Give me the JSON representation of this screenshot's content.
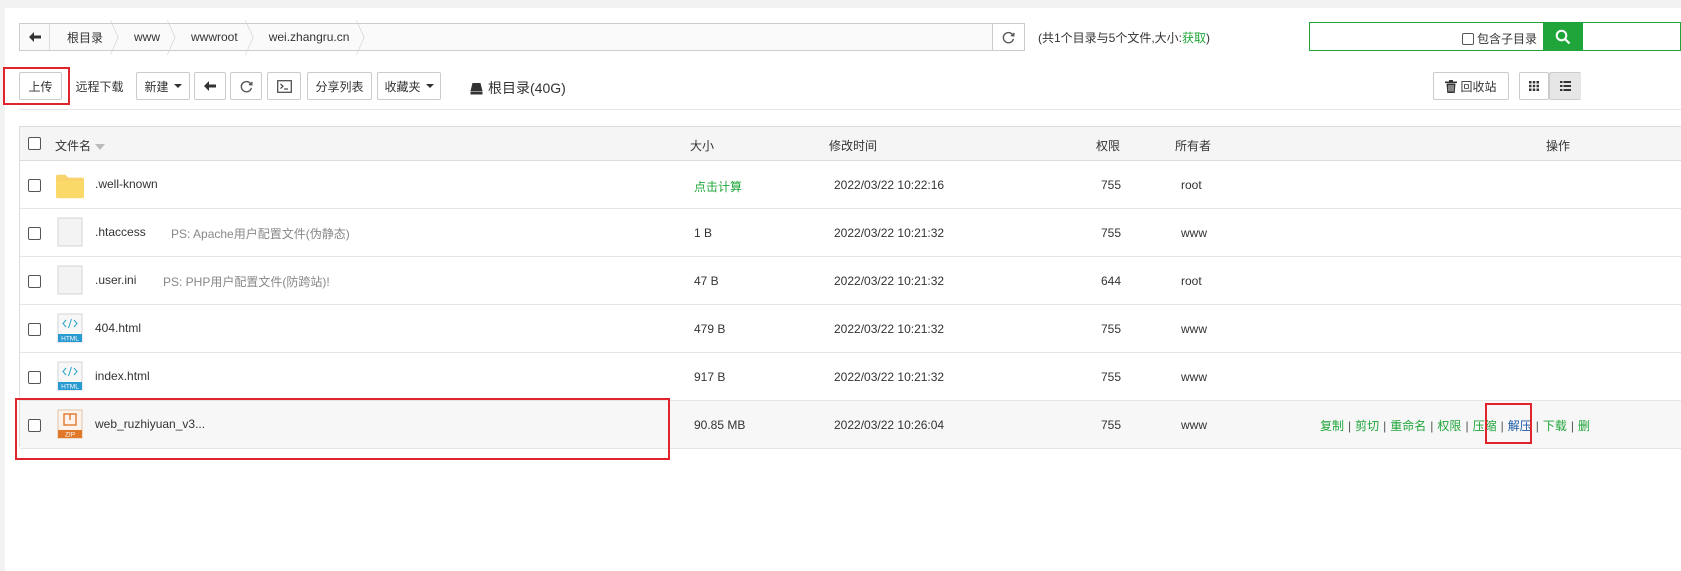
{
  "breadcrumb": {
    "items": [
      "根目录",
      "www",
      "wwwroot",
      "wei.zhangru.cn"
    ]
  },
  "summary": {
    "text": "(共1个目录与5个文件,大小:",
    "fetch": "获取",
    "close": ")"
  },
  "search": {
    "placeholder": "",
    "include_sub": "包含子目录"
  },
  "toolbar": {
    "upload": "上传",
    "remote_download": "远程下载",
    "new": "新建",
    "share_list": "分享列表",
    "favorites": "收藏夹",
    "disk": "根目录(40G)",
    "recycle": "回收站"
  },
  "table": {
    "headers": {
      "name": "文件名",
      "size": "大小",
      "mtime": "修改时间",
      "perm": "权限",
      "owner": "所有者",
      "ops": "操作"
    },
    "rows": [
      {
        "icon": "folder",
        "name": ".well-known",
        "ps": "",
        "size": "点击计算",
        "mtime": "2022/03/22 10:22:16",
        "perm": "755",
        "owner": "root"
      },
      {
        "icon": "file",
        "name": ".htaccess",
        "ps": "PS: Apache用户配置文件(伪静态)",
        "size": "1 B",
        "mtime": "2022/03/22 10:21:32",
        "perm": "755",
        "owner": "www"
      },
      {
        "icon": "file",
        "name": ".user.ini",
        "ps": "PS: PHP用户配置文件(防跨站)!",
        "size": "47 B",
        "mtime": "2022/03/22 10:21:32",
        "perm": "644",
        "owner": "root"
      },
      {
        "icon": "html",
        "name": "404.html",
        "ps": "",
        "size": "479 B",
        "mtime": "2022/03/22 10:21:32",
        "perm": "755",
        "owner": "www"
      },
      {
        "icon": "html",
        "name": "index.html",
        "ps": "",
        "size": "917 B",
        "mtime": "2022/03/22 10:21:32",
        "perm": "755",
        "owner": "www"
      },
      {
        "icon": "zip",
        "name": "web_ruzhiyuan_v3...",
        "ps": "",
        "size": "90.85 MB",
        "mtime": "2022/03/22 10:26:04",
        "perm": "755",
        "owner": "www"
      }
    ],
    "row_ops": [
      "复制",
      "剪切",
      "重命名",
      "权限",
      "压缩",
      "解压",
      "下载",
      "删"
    ],
    "icon_labels": {
      "html": "HTML",
      "zip": "ZIP"
    }
  },
  "colors": {
    "accent": "#20a53a",
    "highlight": "#e0242b",
    "link": "#1e5aa5"
  }
}
